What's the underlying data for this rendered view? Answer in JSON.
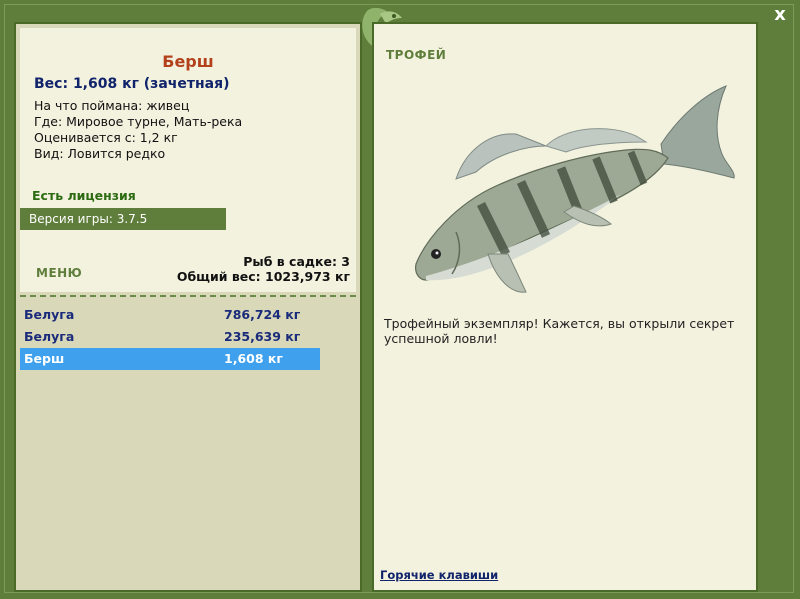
{
  "window": {
    "close_label": "x"
  },
  "fish": {
    "name": "Берш",
    "weight": "Вес: 1,608 кг (зачетная)",
    "caught_on": "На что поймана: живец",
    "location": "Где: Мировое турне, Мать-река",
    "value": "Оценивается с: 1,2 кг",
    "species_rarity": "Вид: Ловится редко"
  },
  "license": "Есть лицензия",
  "version": "Версия игры: 3.7.5",
  "menu": {
    "label": "МЕНЮ"
  },
  "keepnet": {
    "count": "Рыб в садке: 3",
    "total_weight": "Общий вес: 1023,973 кг"
  },
  "catch_list": [
    {
      "name": "Белуга",
      "weight": "786,724 кг"
    },
    {
      "name": "Белуга",
      "weight": "235,639 кг"
    },
    {
      "name": "Берш",
      "weight": "1,608 кг"
    }
  ],
  "trophy": {
    "label": "ТРОФЕЙ",
    "description": "Трофейный экземпляр! Кажется, вы открыли секрет успешной ловли!"
  },
  "hotkeys_link": "Горячие клавиши",
  "colors": {
    "accent": "#5f7d3b",
    "selected": "#3fa1ed",
    "title": "#b3421c"
  }
}
